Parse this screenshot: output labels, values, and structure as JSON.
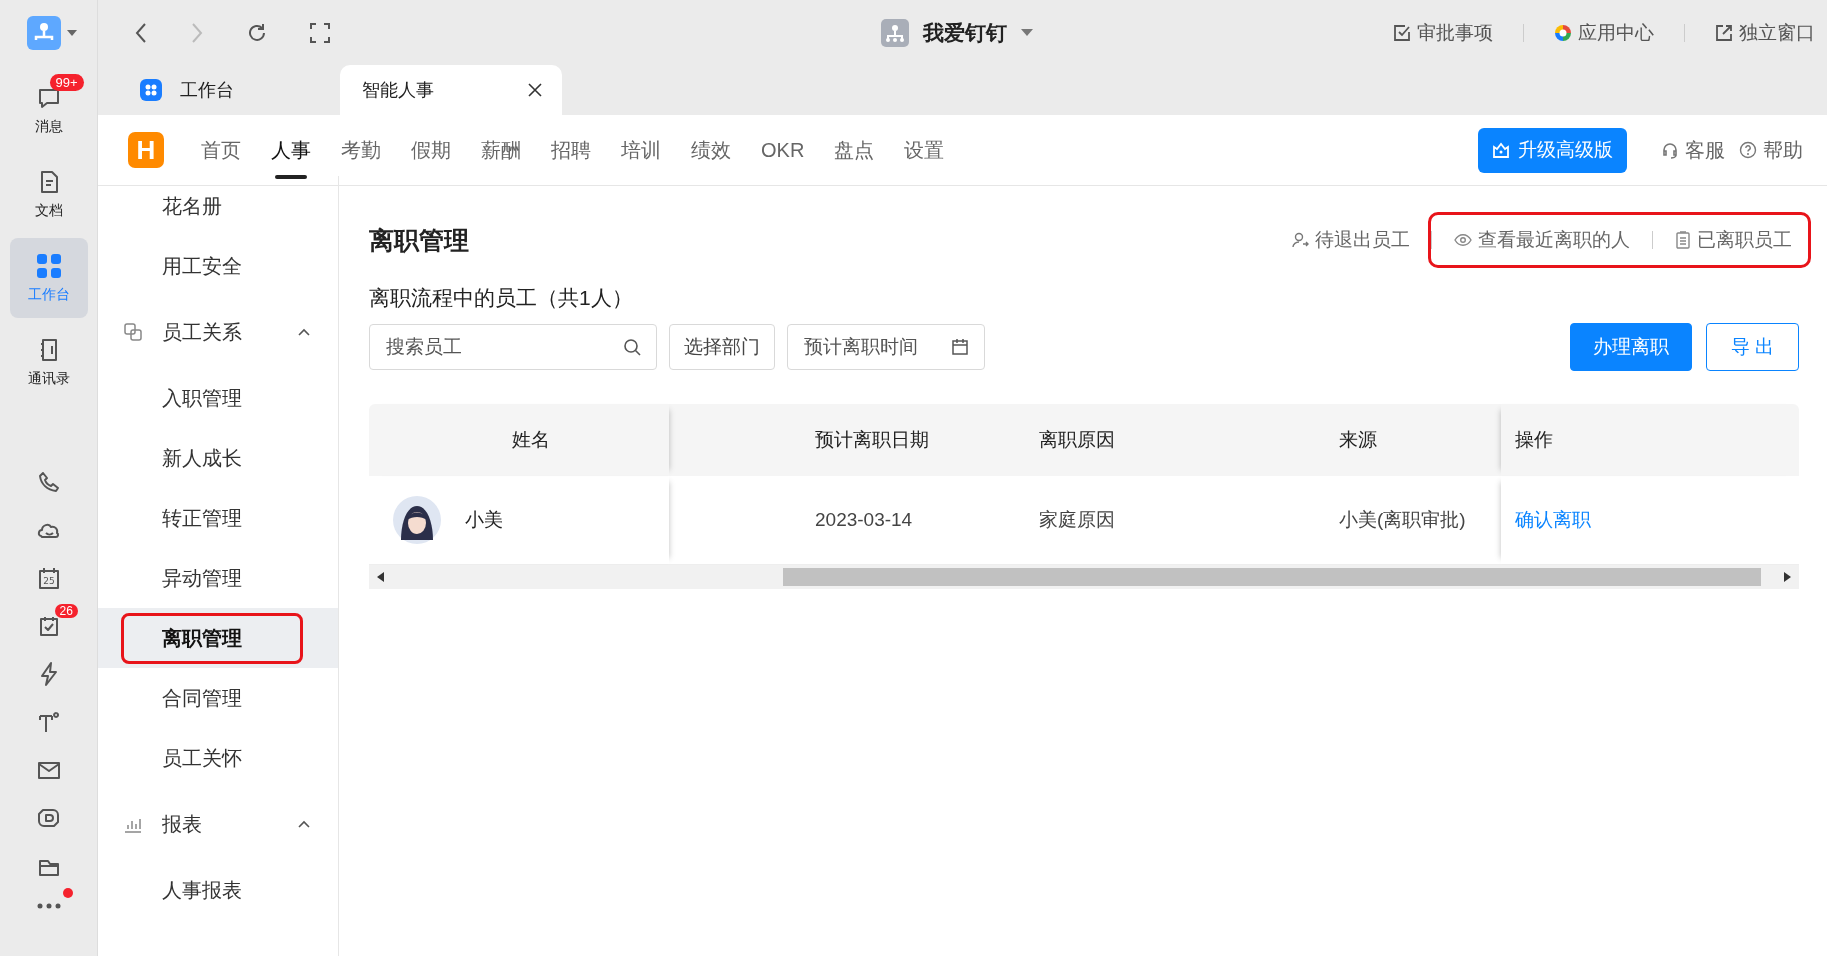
{
  "rail": {
    "items": [
      {
        "label": "消息",
        "selected": false,
        "badge": "99+"
      },
      {
        "label": "文档",
        "selected": false
      },
      {
        "label": "工作台",
        "selected": true
      },
      {
        "label": "通讯录",
        "selected": false
      }
    ],
    "tools": {
      "calendar_glyph": "25",
      "todo_badge": "26"
    },
    "more": {
      "dot": true
    }
  },
  "topbar": {
    "org": "我爱钉钉",
    "forward_disabled": true,
    "actions": [
      "审批事项",
      "应用中心",
      "独立窗口"
    ]
  },
  "tabs": [
    {
      "label": "工作台",
      "selected": false
    },
    {
      "label": "智能人事",
      "selected": true
    }
  ],
  "nav": {
    "logo": "H",
    "items": [
      {
        "label": "首页",
        "selected": false
      },
      {
        "label": "人事",
        "selected": true
      },
      {
        "label": "考勤",
        "selected": false
      },
      {
        "label": "假期",
        "selected": false
      },
      {
        "label": "薪酬",
        "selected": false
      },
      {
        "label": "招聘",
        "selected": false
      },
      {
        "label": "培训",
        "selected": false
      },
      {
        "label": "绩效",
        "selected": false
      },
      {
        "label": "OKR",
        "selected": false
      },
      {
        "label": "盘点",
        "selected": false
      },
      {
        "label": "设置",
        "selected": false
      }
    ],
    "upgrade": "升级高级版",
    "links": [
      "客服",
      "帮助"
    ]
  },
  "sidebar": {
    "items": [
      {
        "label": "花名册",
        "selected": false,
        "circled": false
      },
      {
        "label": "用工安全",
        "selected": false,
        "circled": false
      },
      {
        "label": "员工关系",
        "expanded": true,
        "children": [
          {
            "label": "入职管理",
            "selected": false,
            "circled": false
          },
          {
            "label": "新人成长",
            "selected": false,
            "circled": false
          },
          {
            "label": "转正管理",
            "selected": false,
            "circled": false
          },
          {
            "label": "异动管理",
            "selected": false,
            "circled": false
          },
          {
            "label": "离职管理",
            "selected": true,
            "circled": true
          },
          {
            "label": "合同管理",
            "selected": false,
            "circled": false
          },
          {
            "label": "员工关怀",
            "selected": false,
            "circled": false
          }
        ]
      },
      {
        "label": "报表",
        "expanded": true,
        "children": [
          {
            "label": "人事报表",
            "selected": false,
            "circled": false
          }
        ]
      }
    ]
  },
  "main": {
    "title": "离职管理",
    "header_links": [
      {
        "label": "待退出员工",
        "circled": false
      },
      {
        "label": "查看最近离职的人",
        "circled": true
      },
      {
        "label": "已离职员工",
        "circled": true
      }
    ],
    "subtitle": "离职流程中的员工（共1人）",
    "search": {
      "placeholder": "搜索员工"
    },
    "department": "选择部门",
    "date_filter": {
      "placeholder": "预计离职时间"
    },
    "buttons": [
      {
        "label": "办理离职",
        "kind": "primary"
      },
      {
        "label": "导 出",
        "kind": "outline"
      }
    ],
    "table": {
      "columns": [
        "姓名",
        "",
        "预计离职日期",
        "离职原因",
        "来源",
        "操作"
      ],
      "rows": [
        {
          "name": "小美",
          "date": "2023-03-14",
          "reason": "家庭原因",
          "source": "小美(离职审批)",
          "action": "确认离职"
        }
      ]
    }
  }
}
